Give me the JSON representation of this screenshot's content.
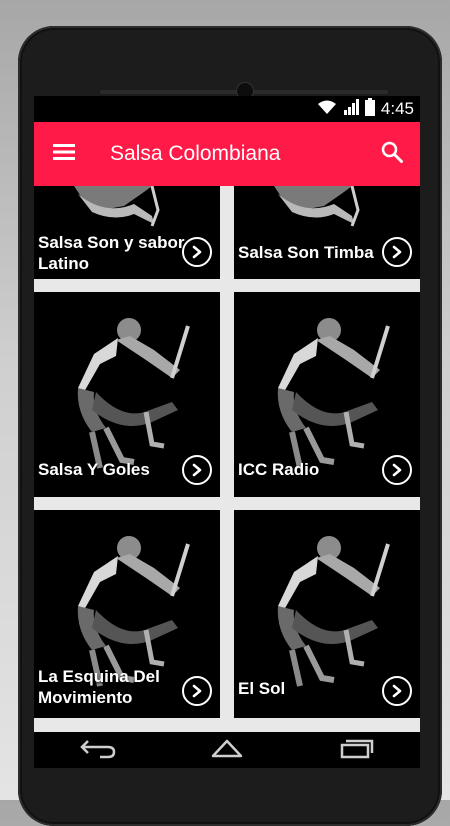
{
  "status": {
    "time": "4:45"
  },
  "appbar": {
    "title": "Salsa Colombiana",
    "accent": "#ff1a47"
  },
  "icons": {
    "menu": "hamburger-menu-icon",
    "search": "search-icon",
    "play": "play-circle-icon",
    "back": "back-icon",
    "home": "home-icon",
    "recents": "recent-apps-icon"
  },
  "stations": [
    {
      "name": "Salsa Son y sabor Latino"
    },
    {
      "name": "Salsa Son Timba"
    },
    {
      "name": "Salsa Y Goles"
    },
    {
      "name": "ICC Radio"
    },
    {
      "name": "La Esquina Del Movimiento"
    },
    {
      "name": "El Sol"
    }
  ]
}
